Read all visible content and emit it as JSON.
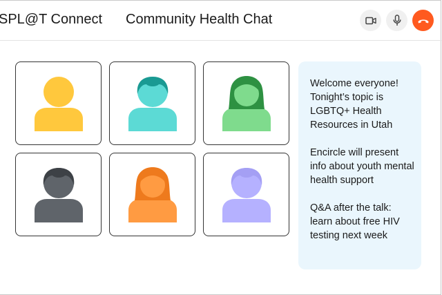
{
  "header": {
    "app_name": "SPL@T Connect",
    "chat_title": "Community Health Chat",
    "controls": [
      {
        "name": "video-icon",
        "color": "#555555"
      },
      {
        "name": "microphone-icon",
        "color": "#555555"
      },
      {
        "name": "end-call-icon",
        "color": "#ff5a1f"
      }
    ]
  },
  "participants": [
    {
      "avatar": "short-hair",
      "color": "#ffc83d",
      "hair": "#ffc83d"
    },
    {
      "avatar": "short-hair",
      "color": "#5cdad5",
      "hair": "#1a9a93"
    },
    {
      "avatar": "long-hair",
      "color": "#7fdb8d",
      "hair": "#2e9142"
    },
    {
      "avatar": "short-hair",
      "color": "#5f646a",
      "hair": "#3d4146"
    },
    {
      "avatar": "long-hair",
      "color": "#ff9b42",
      "hair": "#ee7a1d"
    },
    {
      "avatar": "short-hair",
      "color": "#b5b1ff",
      "hair": "#a49ff4"
    }
  ],
  "messages": [
    "Welcome everyone! Tonight’s topic is LGBTQ+ Health Resources in Utah",
    "Encircle will present info about youth mental health support",
    "Q&A after the talk: learn about free HIV testing next week"
  ]
}
